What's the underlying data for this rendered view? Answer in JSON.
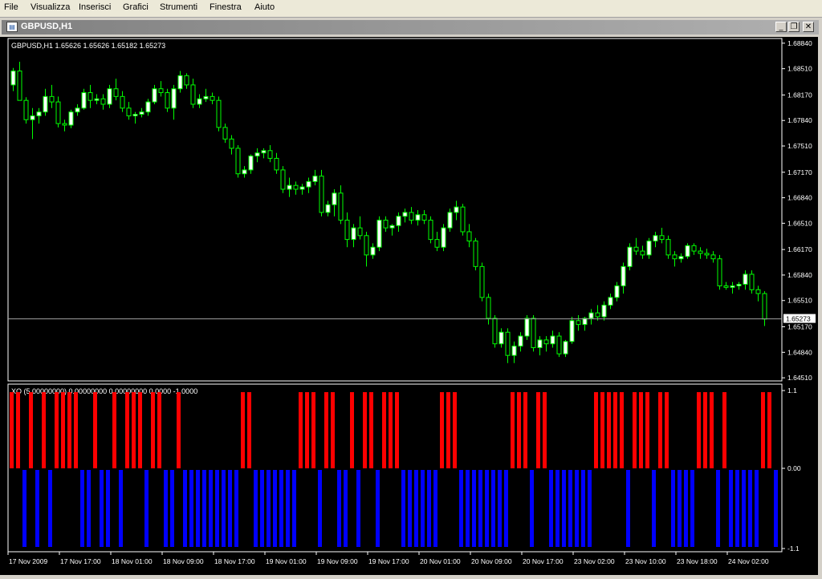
{
  "menu": [
    {
      "label": "File"
    },
    {
      "label": "Visualizza"
    },
    {
      "label": "Inserisci"
    },
    {
      "label": "Grafici"
    },
    {
      "label": "Strumenti"
    },
    {
      "label": "Finestra"
    },
    {
      "label": "Aiuto"
    }
  ],
  "window": {
    "title": "GBPUSD,H1",
    "icon": "chart-window-icon",
    "buttons": [
      "minimize-icon",
      "restore-icon",
      "close-icon"
    ]
  },
  "colors": {
    "background": "#000000",
    "bull": "#ffffff",
    "bear": "#000000",
    "wick": "#00ff00",
    "grid_text": "#ffffff",
    "xo_up": "#ff0000",
    "xo_down": "#0000ff"
  },
  "chart_data": [
    {
      "type": "candlestick",
      "title": "GBPUSD,H1  1.65626 1.65626 1.65182 1.65273",
      "y_ticks": [
        "1.68840",
        "1.68510",
        "1.68170",
        "1.67840",
        "1.67510",
        "1.67170",
        "1.66840",
        "1.66510",
        "1.66170",
        "1.65840",
        "1.65510",
        "1.65170",
        "1.64840",
        "1.64510"
      ],
      "ylim": [
        1.6448,
        1.6888
      ],
      "current_price": "1.65273",
      "x_ticks": [
        "17 Nov 2009",
        "17 Nov 17:00",
        "18 Nov 01:00",
        "18 Nov 09:00",
        "18 Nov 17:00",
        "19 Nov 01:00",
        "19 Nov 09:00",
        "19 Nov 17:00",
        "20 Nov 01:00",
        "20 Nov 09:00",
        "20 Nov 17:00",
        "23 Nov 02:00",
        "23 Nov 10:00",
        "23 Nov 18:00",
        "24 Nov 02:00"
      ],
      "candles": [
        [
          1.683,
          1.6852,
          1.6822,
          1.6848
        ],
        [
          1.6848,
          1.686,
          1.681,
          1.681
        ],
        [
          1.681,
          1.6814,
          1.678,
          1.6785
        ],
        [
          1.6785,
          1.68,
          1.676,
          1.679
        ],
        [
          1.679,
          1.68,
          1.678,
          1.6795
        ],
        [
          1.6795,
          1.6825,
          1.679,
          1.6815
        ],
        [
          1.6815,
          1.683,
          1.68,
          1.6808
        ],
        [
          1.6808,
          1.6815,
          1.6775,
          1.678
        ],
        [
          1.678,
          1.6785,
          1.677,
          1.6778
        ],
        [
          1.6778,
          1.6798,
          1.6774,
          1.6795
        ],
        [
          1.6795,
          1.6805,
          1.679,
          1.68
        ],
        [
          1.68,
          1.6825,
          1.6798,
          1.682
        ],
        [
          1.682,
          1.683,
          1.68,
          1.681
        ],
        [
          1.681,
          1.6818,
          1.6805,
          1.6812
        ],
        [
          1.6812,
          1.6818,
          1.6798,
          1.6805
        ],
        [
          1.6805,
          1.683,
          1.68,
          1.6825
        ],
        [
          1.6825,
          1.6838,
          1.681,
          1.6815
        ],
        [
          1.6815,
          1.6822,
          1.6795,
          1.68
        ],
        [
          1.68,
          1.6808,
          1.6785,
          1.679
        ],
        [
          1.679,
          1.6795,
          1.678,
          1.6792
        ],
        [
          1.6792,
          1.68,
          1.6788,
          1.6795
        ],
        [
          1.6795,
          1.6812,
          1.679,
          1.6808
        ],
        [
          1.6808,
          1.683,
          1.6805,
          1.6825
        ],
        [
          1.6825,
          1.6835,
          1.6815,
          1.682
        ],
        [
          1.682,
          1.6825,
          1.6795,
          1.68
        ],
        [
          1.68,
          1.683,
          1.6785,
          1.6825
        ],
        [
          1.6825,
          1.6848,
          1.682,
          1.6842
        ],
        [
          1.6842,
          1.6845,
          1.6825,
          1.683
        ],
        [
          1.683,
          1.6838,
          1.68,
          1.6805
        ],
        [
          1.6805,
          1.6818,
          1.68,
          1.6812
        ],
        [
          1.6812,
          1.6825,
          1.6808,
          1.6815
        ],
        [
          1.6815,
          1.682,
          1.6805,
          1.681
        ],
        [
          1.681,
          1.6815,
          1.677,
          1.6775
        ],
        [
          1.6775,
          1.678,
          1.6755,
          1.676
        ],
        [
          1.676,
          1.6765,
          1.674,
          1.6748
        ],
        [
          1.6748,
          1.6752,
          1.671,
          1.6715
        ],
        [
          1.6715,
          1.6725,
          1.671,
          1.672
        ],
        [
          1.672,
          1.674,
          1.6715,
          1.6738
        ],
        [
          1.6738,
          1.6748,
          1.673,
          1.6742
        ],
        [
          1.6742,
          1.6748,
          1.6735,
          1.6745
        ],
        [
          1.6745,
          1.6752,
          1.673,
          1.6735
        ],
        [
          1.6735,
          1.6742,
          1.6715,
          1.672
        ],
        [
          1.672,
          1.6725,
          1.669,
          1.6695
        ],
        [
          1.6695,
          1.671,
          1.6685,
          1.67
        ],
        [
          1.67,
          1.6705,
          1.6688,
          1.6695
        ],
        [
          1.6695,
          1.6702,
          1.6688,
          1.6698
        ],
        [
          1.6698,
          1.671,
          1.669,
          1.6705
        ],
        [
          1.6705,
          1.672,
          1.67,
          1.6712
        ],
        [
          1.6712,
          1.672,
          1.666,
          1.6665
        ],
        [
          1.6665,
          1.668,
          1.666,
          1.6675
        ],
        [
          1.6675,
          1.6695,
          1.666,
          1.669
        ],
        [
          1.669,
          1.67,
          1.665,
          1.6655
        ],
        [
          1.6655,
          1.6665,
          1.662,
          1.663
        ],
        [
          1.663,
          1.665,
          1.662,
          1.6645
        ],
        [
          1.6645,
          1.666,
          1.663,
          1.6635
        ],
        [
          1.6635,
          1.664,
          1.6595,
          1.661
        ],
        [
          1.661,
          1.6625,
          1.6605,
          1.662
        ],
        [
          1.662,
          1.666,
          1.6615,
          1.6655
        ],
        [
          1.6655,
          1.666,
          1.664,
          1.6645
        ],
        [
          1.6645,
          1.665,
          1.6635,
          1.6648
        ],
        [
          1.6648,
          1.6665,
          1.664,
          1.666
        ],
        [
          1.666,
          1.667,
          1.6652,
          1.6665
        ],
        [
          1.6665,
          1.6672,
          1.665,
          1.6655
        ],
        [
          1.6655,
          1.6668,
          1.6648,
          1.6662
        ],
        [
          1.6662,
          1.6668,
          1.665,
          1.6655
        ],
        [
          1.6655,
          1.666,
          1.6625,
          1.663
        ],
        [
          1.663,
          1.664,
          1.6615,
          1.662
        ],
        [
          1.662,
          1.665,
          1.6615,
          1.6645
        ],
        [
          1.6645,
          1.667,
          1.664,
          1.6665
        ],
        [
          1.6665,
          1.668,
          1.6655,
          1.6672
        ],
        [
          1.6672,
          1.6676,
          1.6635,
          1.664
        ],
        [
          1.664,
          1.665,
          1.662,
          1.6628
        ],
        [
          1.6628,
          1.6632,
          1.659,
          1.6595
        ],
        [
          1.6595,
          1.66,
          1.655,
          1.6555
        ],
        [
          1.6555,
          1.656,
          1.652,
          1.6528
        ],
        [
          1.6528,
          1.6532,
          1.649,
          1.6495
        ],
        [
          1.6495,
          1.6515,
          1.649,
          1.651
        ],
        [
          1.651,
          1.6515,
          1.647,
          1.648
        ],
        [
          1.648,
          1.6498,
          1.647,
          1.6492
        ],
        [
          1.6492,
          1.651,
          1.6485,
          1.6505
        ],
        [
          1.6505,
          1.6532,
          1.65,
          1.6528
        ],
        [
          1.6528,
          1.6532,
          1.6485,
          1.649
        ],
        [
          1.649,
          1.6505,
          1.648,
          1.65
        ],
        [
          1.65,
          1.6505,
          1.6485,
          1.6495
        ],
        [
          1.6495,
          1.6512,
          1.649,
          1.6505
        ],
        [
          1.6505,
          1.651,
          1.6478,
          1.6482
        ],
        [
          1.6482,
          1.65,
          1.6478,
          1.6498
        ],
        [
          1.6498,
          1.653,
          1.6495,
          1.6525
        ],
        [
          1.6525,
          1.6532,
          1.6512,
          1.652
        ],
        [
          1.652,
          1.653,
          1.6512,
          1.6528
        ],
        [
          1.6528,
          1.654,
          1.652,
          1.6535
        ],
        [
          1.6535,
          1.6545,
          1.6525,
          1.653
        ],
        [
          1.653,
          1.655,
          1.6525,
          1.6545
        ],
        [
          1.6545,
          1.656,
          1.654,
          1.6555
        ],
        [
          1.6555,
          1.6575,
          1.655,
          1.657
        ],
        [
          1.657,
          1.66,
          1.656,
          1.6595
        ],
        [
          1.6595,
          1.6625,
          1.659,
          1.662
        ],
        [
          1.662,
          1.6632,
          1.661,
          1.6615
        ],
        [
          1.6615,
          1.6622,
          1.6605,
          1.661
        ],
        [
          1.661,
          1.6632,
          1.6605,
          1.6628
        ],
        [
          1.6628,
          1.664,
          1.662,
          1.6635
        ],
        [
          1.6635,
          1.6645,
          1.6625,
          1.663
        ],
        [
          1.663,
          1.6635,
          1.6605,
          1.661
        ],
        [
          1.661,
          1.6615,
          1.6595,
          1.6605
        ],
        [
          1.6605,
          1.6612,
          1.66,
          1.6608
        ],
        [
          1.6608,
          1.6625,
          1.6605,
          1.6622
        ],
        [
          1.6622,
          1.6625,
          1.661,
          1.6615
        ],
        [
          1.6615,
          1.662,
          1.6605,
          1.6612
        ],
        [
          1.6612,
          1.6618,
          1.6605,
          1.661
        ],
        [
          1.661,
          1.6615,
          1.66,
          1.6605
        ],
        [
          1.6605,
          1.661,
          1.6565,
          1.657
        ],
        [
          1.657,
          1.6575,
          1.6565,
          1.6568
        ],
        [
          1.6568,
          1.6575,
          1.656,
          1.657
        ],
        [
          1.657,
          1.6575,
          1.6565,
          1.6572
        ],
        [
          1.6572,
          1.659,
          1.6565,
          1.6585
        ],
        [
          1.6585,
          1.659,
          1.656,
          1.6565
        ],
        [
          1.6565,
          1.657,
          1.655,
          1.656
        ],
        [
          1.656,
          1.6563,
          1.6518,
          1.6527
        ]
      ]
    },
    {
      "type": "bar",
      "title": "XO (5.00000000) 0.00000000 0.00000000 0.0000 -1.0000",
      "y_ticks": [
        "1.1",
        "0.00",
        "-1.1"
      ],
      "ylim": [
        -1.1,
        1.1
      ],
      "series": [
        {
          "name": "",
          "values": [
            1,
            1,
            0,
            1,
            0,
            1,
            0,
            1,
            1,
            1,
            1,
            0,
            0,
            1,
            0,
            0,
            1,
            0,
            1,
            1,
            1,
            0,
            1,
            1,
            0,
            0,
            1,
            0,
            0,
            0,
            0,
            0,
            0,
            0,
            0,
            0,
            1,
            1,
            0,
            0,
            0,
            0,
            0,
            0,
            0,
            1,
            1,
            1,
            0,
            1,
            1,
            0,
            0,
            1,
            0,
            1,
            1,
            0,
            1,
            1,
            1,
            0,
            0,
            0,
            0,
            0,
            0,
            1,
            1,
            1,
            0,
            0,
            0,
            0,
            0,
            0,
            0,
            0,
            1,
            1,
            1,
            0,
            1,
            1,
            0,
            0,
            0,
            0,
            0,
            0,
            0,
            1,
            1,
            1,
            1,
            1,
            0,
            1,
            1,
            1,
            0,
            1,
            1,
            0,
            0,
            0,
            0,
            1,
            1,
            1,
            0,
            1,
            0,
            0,
            0,
            0,
            0,
            1,
            1,
            0
          ]
        }
      ]
    }
  ]
}
